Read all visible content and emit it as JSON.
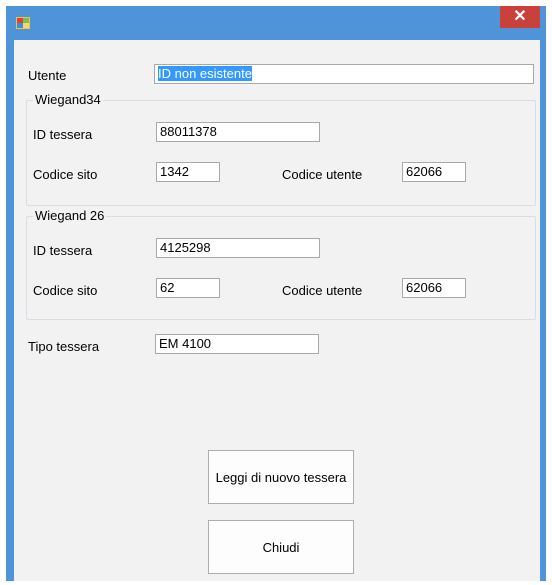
{
  "window": {
    "close_glyph": "✕"
  },
  "form": {
    "user_label": "Utente",
    "user_value": "ID non esistente",
    "card_type_label": "Tipo tessera",
    "card_type_value": "EM 4100"
  },
  "wiegand34": {
    "title": "Wiegand34",
    "card_id_label": "ID tessera",
    "card_id_value": "88011378",
    "site_code_label": "Codice sito",
    "site_code_value": "1342",
    "user_code_label": "Codice utente",
    "user_code_value": "62066"
  },
  "wiegand26": {
    "title": "Wiegand 26",
    "card_id_label": "ID tessera",
    "card_id_value": "4125298",
    "site_code_label": "Codice sito",
    "site_code_value": "62",
    "user_code_label": "Codice utente",
    "user_code_value": "62066"
  },
  "buttons": {
    "read_again": "Leggi di nuovo tessera",
    "close": "Chiudi"
  },
  "colors": {
    "titlebar": "#4f94d9",
    "close_button": "#c9413a",
    "selection": "#3399ff"
  }
}
